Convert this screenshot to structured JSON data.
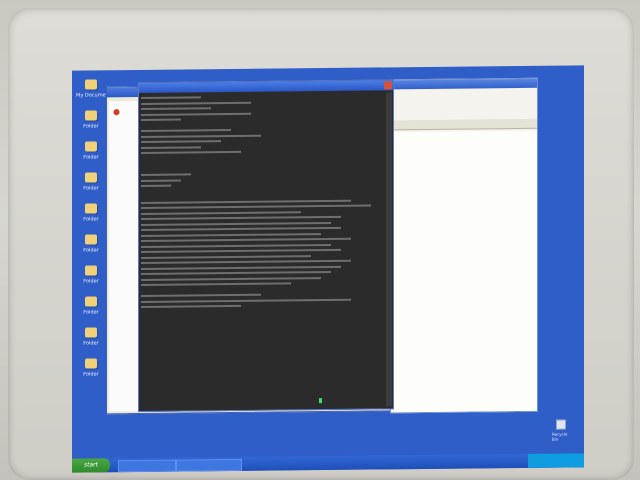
{
  "desktop": {
    "icons": [
      {
        "label": "My Documents",
        "icon": "folder-icon"
      },
      {
        "label": "Folder",
        "icon": "folder-icon"
      },
      {
        "label": "Folder",
        "icon": "folder-icon"
      },
      {
        "label": "Folder",
        "icon": "folder-icon"
      },
      {
        "label": "Folder",
        "icon": "folder-icon"
      },
      {
        "label": "Folder",
        "icon": "folder-icon"
      },
      {
        "label": "Folder",
        "icon": "folder-icon"
      },
      {
        "label": "Folder",
        "icon": "folder-icon"
      },
      {
        "label": "Folder",
        "icon": "folder-icon"
      },
      {
        "label": "Folder",
        "icon": "folder-icon"
      }
    ],
    "recycle_bin": "Recycle Bin"
  },
  "terminal": {
    "title": "",
    "cursor_color": "#3fe070"
  },
  "right_window": {
    "toolbar_text": ""
  },
  "taskbar": {
    "start_label": "start",
    "tasks": [
      "",
      ""
    ],
    "clock": ""
  },
  "colors": {
    "desktop": "#2f5ec8",
    "terminal_bg": "#2b2b2b",
    "titlebar": "#2a56c6"
  }
}
